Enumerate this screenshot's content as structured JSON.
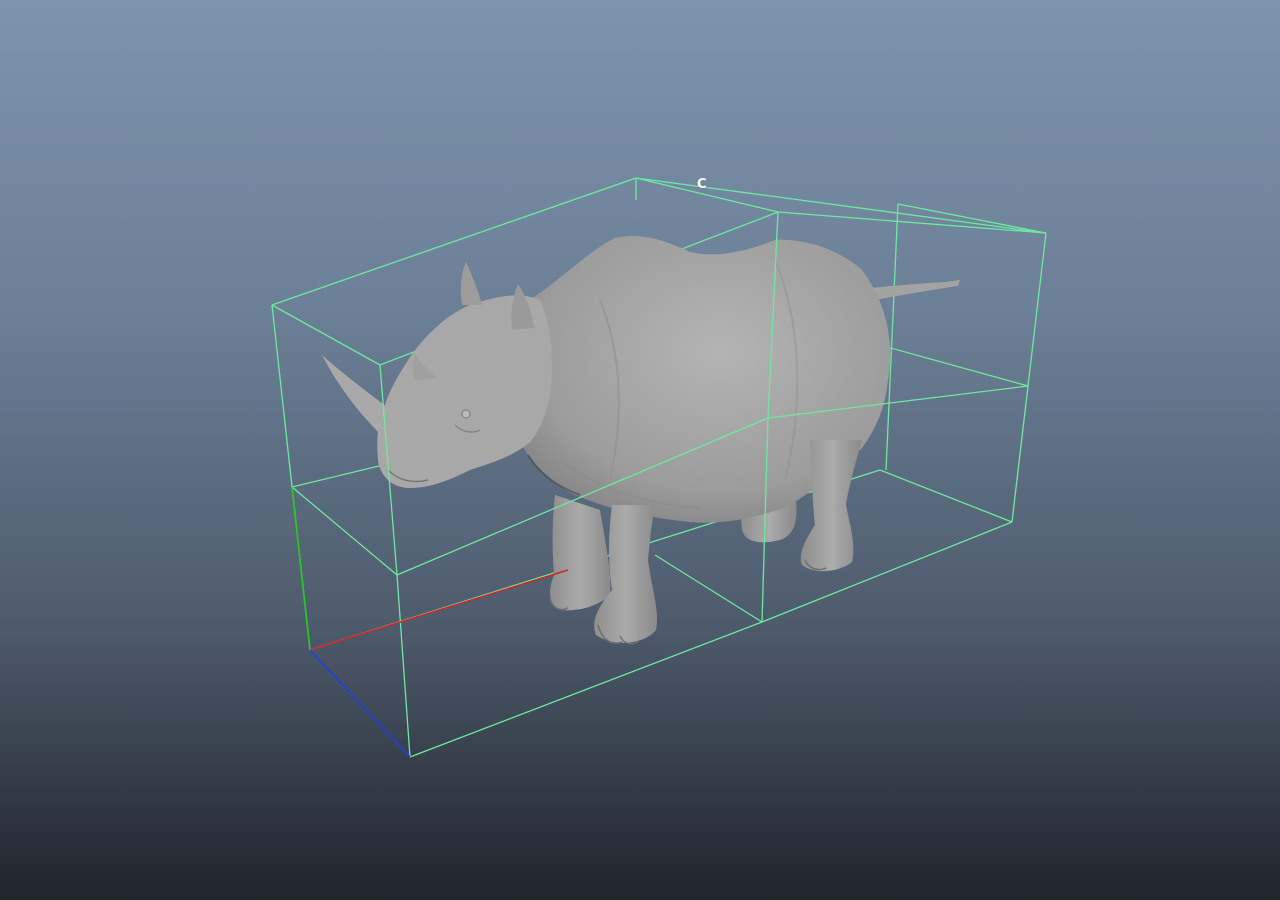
{
  "viewport": {
    "background_top": "#7e94ac",
    "background_bottom": "#20242b"
  },
  "lattice": {
    "label": "C",
    "line_color": "#6ee8a0",
    "label_color": "#ffffff"
  },
  "axes": {
    "x_color": "#d02828",
    "y_color": "#22cc22",
    "z_color": "#2233ee"
  },
  "model": {
    "subject": "rhinoceros",
    "shade_color": "#a6a6a6"
  }
}
